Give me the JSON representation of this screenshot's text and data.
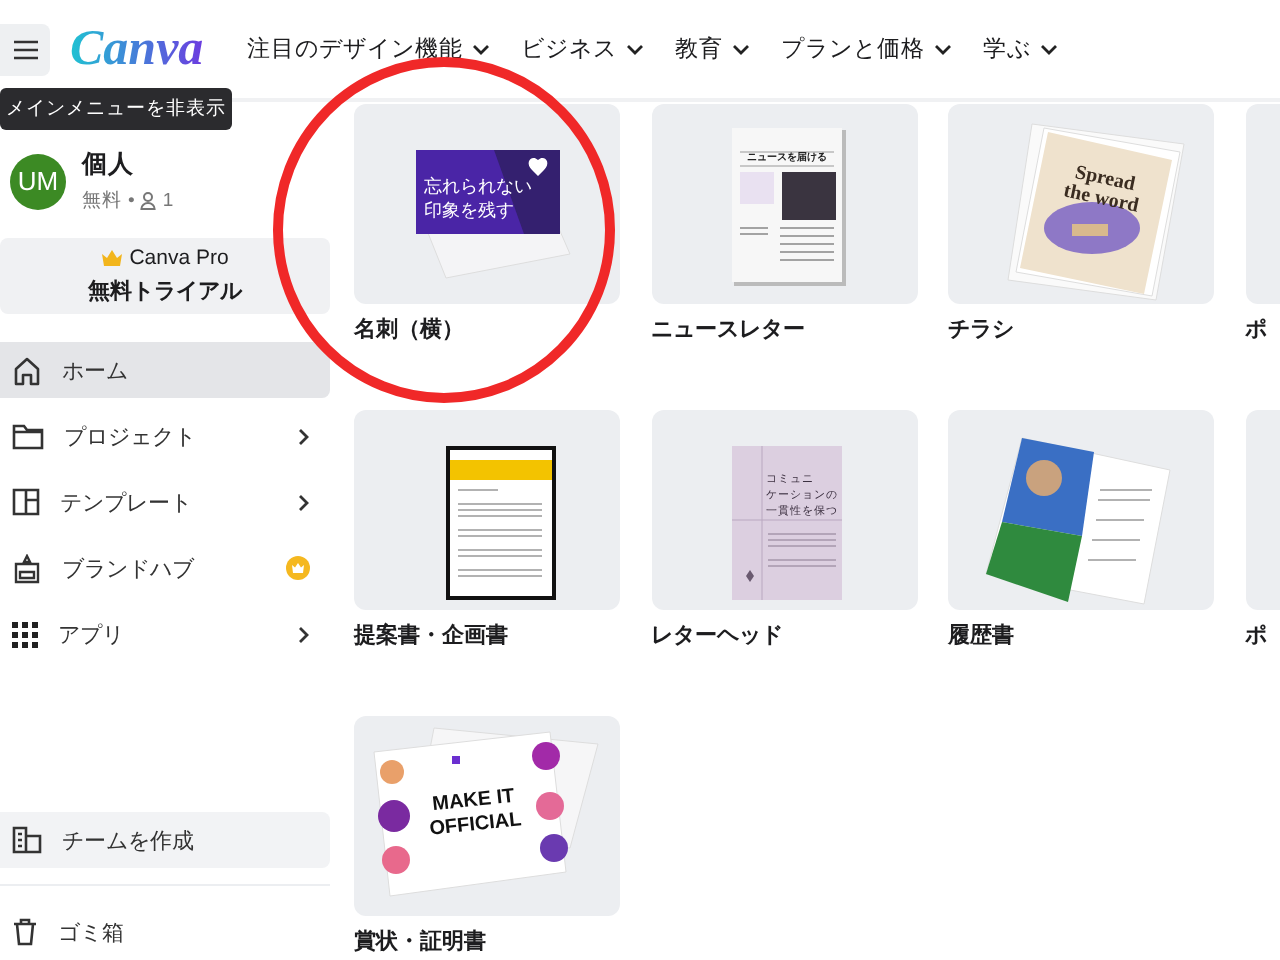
{
  "header": {
    "logo": "Canva",
    "nav": [
      {
        "label": "注目のデザイン機能"
      },
      {
        "label": "ビジネス"
      },
      {
        "label": "教育"
      },
      {
        "label": "プランと価格"
      },
      {
        "label": "学ぶ"
      }
    ],
    "tooltip": "メインメニューを非表示"
  },
  "account": {
    "avatar": "UM",
    "name": "個人",
    "plan": "無料",
    "separator": "•",
    "members": "1"
  },
  "pro_button": {
    "title": "Canva Pro",
    "subtitle": "無料トライアル"
  },
  "sidebar": {
    "items": [
      {
        "label": "ホーム",
        "selected": true,
        "submenu": false,
        "pro": false
      },
      {
        "label": "プロジェクト",
        "selected": false,
        "submenu": true,
        "pro": false
      },
      {
        "label": "テンプレート",
        "selected": false,
        "submenu": true,
        "pro": false
      },
      {
        "label": "ブランドハブ",
        "selected": false,
        "submenu": false,
        "pro": true
      },
      {
        "label": "アプリ",
        "selected": false,
        "submenu": true,
        "pro": false
      }
    ],
    "bottom_items": [
      {
        "label": "チームを作成",
        "highlighted": true
      },
      {
        "label": "ゴミ箱",
        "highlighted": false
      }
    ]
  },
  "templates": [
    {
      "kind": "business-card",
      "label": "名刺（横）",
      "headline": [
        "忘れられない",
        "印象を残す"
      ]
    },
    {
      "kind": "newsletter",
      "label": "ニュースレター",
      "headline": [
        "ニュースを届ける"
      ]
    },
    {
      "kind": "flyer",
      "label": "チラシ",
      "headline": [
        "Spread",
        "the word"
      ]
    },
    {
      "kind": "poster",
      "label": "ポ"
    },
    {
      "kind": "proposal",
      "label": "提案書・企画書"
    },
    {
      "kind": "letterhead",
      "label": "レターヘッド",
      "headline": [
        "コミュニ",
        "ケーションの",
        "一貫性を保つ"
      ]
    },
    {
      "kind": "resume",
      "label": "履歴書"
    },
    {
      "kind": "poster",
      "label": "ポ"
    },
    {
      "kind": "certificate",
      "label": "賞状・証明書",
      "headline": [
        "MAKE IT",
        "OFFICIAL"
      ]
    }
  ],
  "annotation": {
    "kind": "circle",
    "color": "#f02828"
  }
}
